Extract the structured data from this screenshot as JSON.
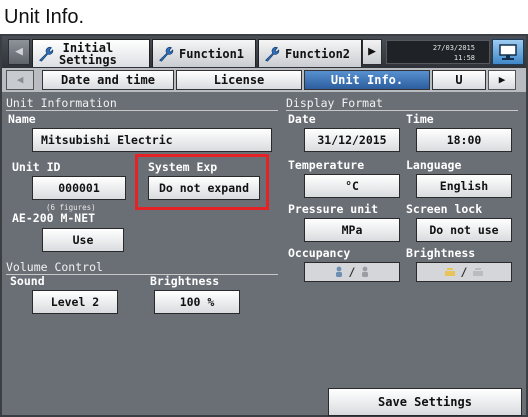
{
  "page_title": "Unit Info.",
  "topbar": {
    "tabs": [
      {
        "label_line1": "Initial",
        "label_line2": "Settings"
      },
      {
        "label": "Function1"
      },
      {
        "label": "Function2"
      }
    ],
    "clock": {
      "date": "27/03/2015",
      "time": "11:58"
    },
    "icons": {
      "tab": "wrench-icon",
      "monitor": "monitor-icon",
      "left": "arrow-left-icon",
      "right": "arrow-right-icon"
    }
  },
  "subtabs": [
    "Date and time",
    "License",
    "Unit Info.",
    "U"
  ],
  "unit_information": {
    "title": "Unit Information",
    "name_label": "Name",
    "name_value": "Mitsubishi Electric",
    "unit_id_label": "Unit ID",
    "unit_id_value": "000001",
    "figures_note": "(6 figures)",
    "system_exp_label": "System Exp",
    "system_exp_value": "Do not expand",
    "mnet_label": "AE-200 M-NET",
    "mnet_value": "Use"
  },
  "display_format": {
    "title": "Display Format",
    "date_label": "Date",
    "date_value": "31/12/2015",
    "time_label": "Time",
    "time_value": "18:00",
    "temperature_label": "Temperature",
    "temperature_value": "°C",
    "language_label": "Language",
    "language_value": "English",
    "pressure_label": "Pressure unit",
    "pressure_value": "MPa",
    "screen_lock_label": "Screen lock",
    "screen_lock_value": "Do not use",
    "occupancy_label": "Occupancy",
    "occupancy_sep": "/",
    "brightness_label": "Brightness",
    "brightness_sep": "/"
  },
  "volume_control": {
    "title": "Volume Control",
    "sound_label": "Sound",
    "sound_value": "Level 2",
    "brightness_label": "Brightness",
    "brightness_value": "100 %"
  },
  "save_label": "Save Settings",
  "colors": {
    "highlight": "#e52226",
    "screen_bg": "#6a6e75",
    "active_tab": "#2c5e9e"
  }
}
